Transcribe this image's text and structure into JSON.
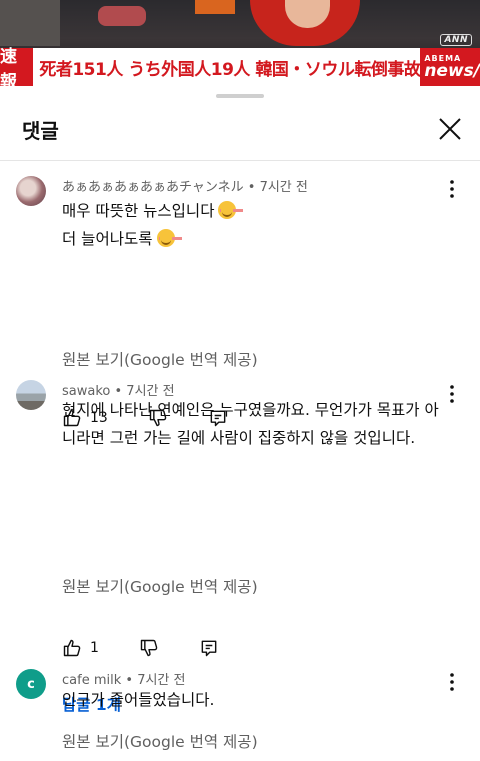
{
  "video": {
    "ann_logo": "ANN",
    "ticker_flash": "速報",
    "ticker_headline": "死者151人 うち外国人19人 韓国・ソウル転倒事故",
    "brand_top": "ABEMA",
    "brand_bottom": "news/"
  },
  "sheet": {
    "title": "댓글",
    "close_icon": "close-icon"
  },
  "comments": [
    {
      "author": "あぁあぁあぁあぁあチャンネル",
      "time": "7시간 전",
      "text_line1": "매우 따뜻한 뉴스입니다",
      "text_line2": "더 늘어나도록",
      "emoji": "smiling-face-emoji",
      "translate_label": "원본 보기(Google 번역 제공)",
      "likes": "13"
    },
    {
      "author": "sawako",
      "time": "7시간 전",
      "text": "현지에 나타난 연예인은 누구였을까요. 무언가가 목표가 아니라면 그런 가는 길에 사람이 집중하지 않을 것입니다.",
      "translate_label": "원본 보기(Google 번역 제공)",
      "likes": "1",
      "replies_label": "답글 1개"
    },
    {
      "author": "cafe milk",
      "avatar_letter": "c",
      "time": "7시간 전",
      "text": "인구가 줄어들었습니다.",
      "translate_label": "원본 보기(Google 번역 제공)"
    }
  ],
  "meta_separator": " • "
}
